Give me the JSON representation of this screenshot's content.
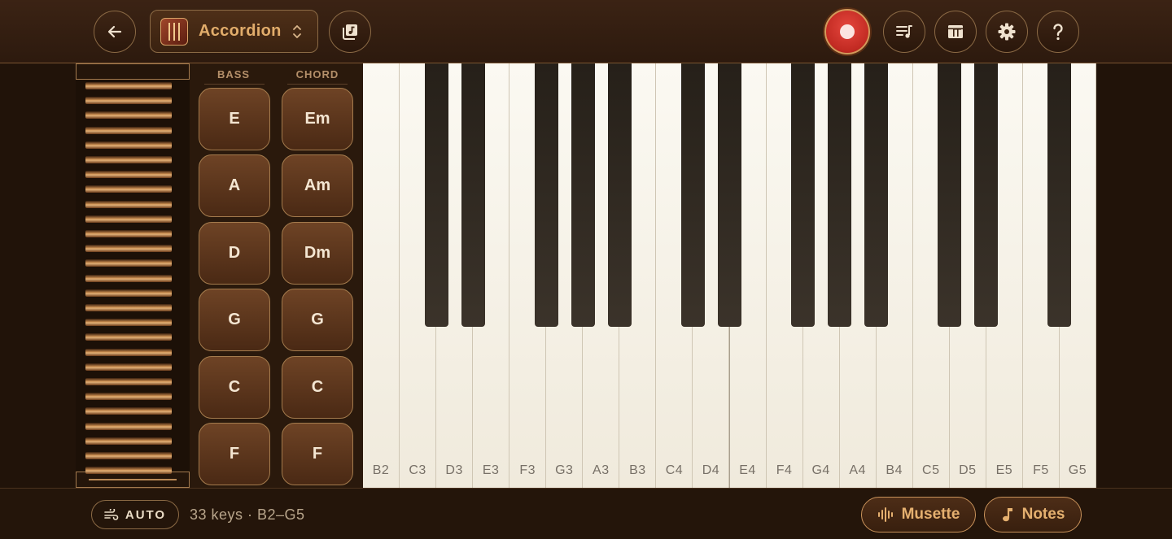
{
  "topbar": {
    "back_icon": "arrow-left-icon",
    "instrument": {
      "name": "Accordion",
      "icon": "accordion-icon",
      "chevron_icon": "chevron-up-down-icon"
    },
    "library_icon": "music-library-icon",
    "record_icon": "record-icon",
    "playlist_icon": "playlist-icon",
    "layout_icon": "layout-icon",
    "settings_icon": "gear-icon",
    "help_icon": "help-icon"
  },
  "panel": {
    "bass_header": "BASS",
    "chord_header": "CHORD",
    "bass": [
      "E",
      "A",
      "D",
      "G",
      "C",
      "F"
    ],
    "chord": [
      "Em",
      "Am",
      "Dm",
      "G",
      "C",
      "F"
    ]
  },
  "keyboard": {
    "white_keys": [
      "B2",
      "C3",
      "D3",
      "E3",
      "F3",
      "G3",
      "A3",
      "B3",
      "C4",
      "D4",
      "E4",
      "F4",
      "G4",
      "A4",
      "B4",
      "C5",
      "D5",
      "E5",
      "F5",
      "G5"
    ]
  },
  "bottombar": {
    "auto_label": "AUTO",
    "keys_info": "33 keys · B2–G5",
    "musette_label": "Musette",
    "notes_label": "Notes"
  },
  "colors": {
    "accent": "#e2ad6b",
    "record": "#d6382f",
    "background": "#211309"
  }
}
